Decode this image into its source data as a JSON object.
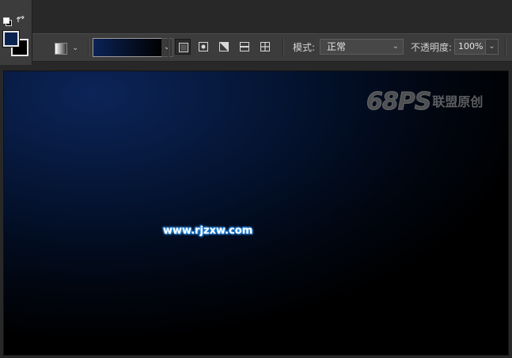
{
  "colors": {
    "foreground": "#0a2250",
    "background": "#000000",
    "gradient_start": "#0b2356",
    "gradient_end": "#000000"
  },
  "tools": {
    "default_colors_icon": "default-colors-icon",
    "swap_colors_icon": "swap-colors-icon"
  },
  "options_bar": {
    "gradient_types": [
      {
        "name": "linear",
        "active": true
      },
      {
        "name": "radial",
        "active": false
      },
      {
        "name": "angle",
        "active": false
      },
      {
        "name": "reflected",
        "active": false
      },
      {
        "name": "diamond",
        "active": false
      }
    ],
    "mode_label": "模式:",
    "mode_value": "正常",
    "opacity_label": "不透明度:",
    "opacity_value": "100%"
  },
  "canvas": {
    "watermark_big": "68PS",
    "watermark_small": "联盟原创",
    "site_text": "www.rjzxw.com"
  }
}
